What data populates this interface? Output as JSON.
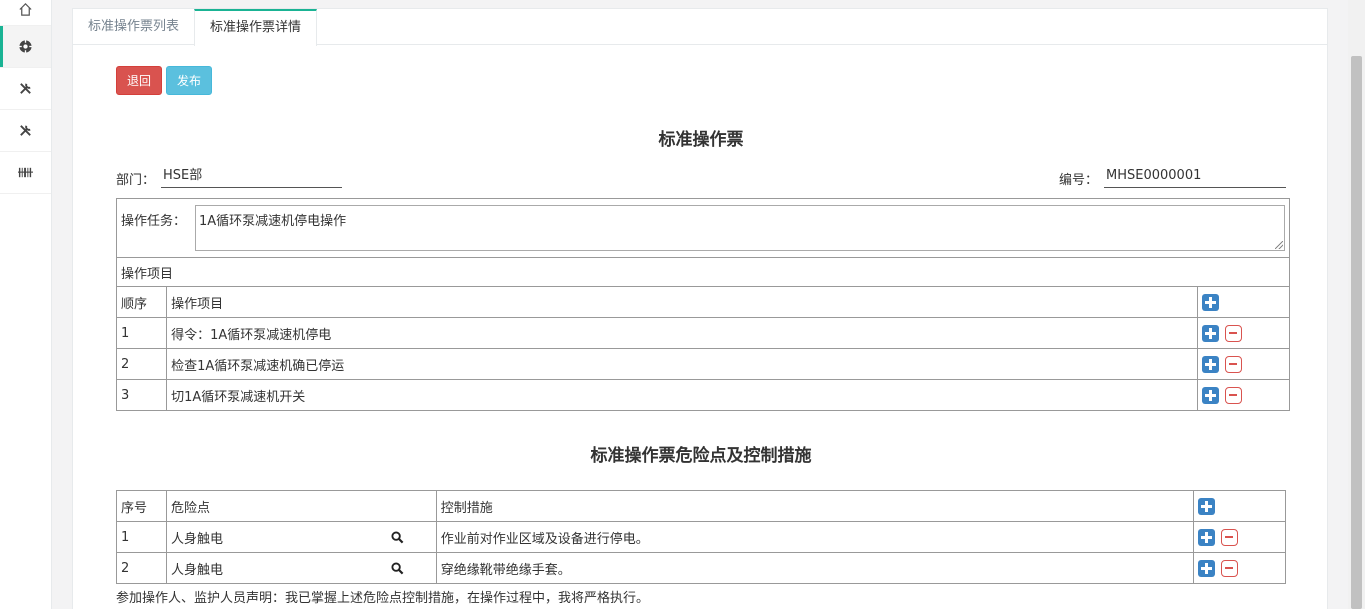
{
  "sidebar": {
    "items": [
      {
        "icon": "home-icon"
      },
      {
        "icon": "target-icon"
      },
      {
        "icon": "wrench-icon"
      },
      {
        "icon": "wrench-icon"
      },
      {
        "icon": "barcode-icon"
      }
    ]
  },
  "tabs": [
    {
      "label": "标准操作票列表"
    },
    {
      "label": "标准操作票详情"
    }
  ],
  "toolbar": {
    "back_label": "退回",
    "publish_label": "发布"
  },
  "form": {
    "title": "标准操作票",
    "department_label": "部门：",
    "department_value": "HSE部",
    "number_label": "编号：",
    "number_value": "MHSE0000001",
    "task_label": "操作任务：",
    "task_value": "1A循环泵减速机停电操作",
    "items_section_label": "操作项目",
    "items_header": {
      "seq": "顺序",
      "item": "操作项目"
    },
    "items": [
      {
        "seq": "1",
        "item": "得令：1A循环泵减速机停电"
      },
      {
        "seq": "2",
        "item": "检查1A循环泵减速机确已停运"
      },
      {
        "seq": "3",
        "item": "切1A循环泵减速机开关"
      }
    ]
  },
  "hazards": {
    "title": "标准操作票危险点及控制措施",
    "header": {
      "seq": "序号",
      "hazard": "危险点",
      "measure": "控制措施"
    },
    "rows": [
      {
        "seq": "1",
        "hazard": "人身触电",
        "measure": "作业前对作业区域及设备进行停电。"
      },
      {
        "seq": "2",
        "hazard": "人身触电",
        "measure": "穿绝缘靴带绝缘手套。"
      }
    ]
  },
  "declaration": "参加操作人、监护人员声明：我已掌握上述危险点控制措施，在操作过程中，我将严格执行。",
  "colors": {
    "accent": "#1ab394",
    "danger": "#d9534f",
    "info": "#5bc0de",
    "add": "#3b83c4"
  }
}
